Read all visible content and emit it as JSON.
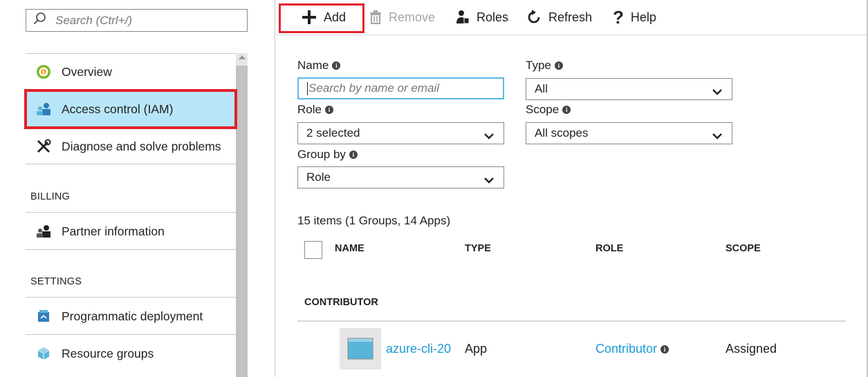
{
  "left": {
    "search_placeholder": "Search (Ctrl+/)",
    "items": [
      {
        "label": "Overview",
        "icon": "overview-icon"
      },
      {
        "label": "Access control (IAM)",
        "icon": "iam-icon",
        "active": true
      },
      {
        "label": "Diagnose and solve problems",
        "icon": "wrench-icon"
      }
    ],
    "sections": [
      {
        "title": "BILLING",
        "items": [
          {
            "label": "Partner information",
            "icon": "users-icon"
          }
        ]
      },
      {
        "title": "SETTINGS",
        "items": [
          {
            "label": "Programmatic deployment",
            "icon": "deployment-icon"
          },
          {
            "label": "Resource groups",
            "icon": "resource-group-icon"
          }
        ]
      }
    ]
  },
  "toolbar": {
    "add": "Add",
    "remove": "Remove",
    "roles": "Roles",
    "refresh": "Refresh",
    "help": "Help"
  },
  "filters": {
    "name_label": "Name",
    "name_placeholder": "Search by name or email",
    "type_label": "Type",
    "type_value": "All",
    "role_label": "Role",
    "role_value": "2 selected",
    "scope_label": "Scope",
    "scope_value": "All scopes",
    "groupby_label": "Group by",
    "groupby_value": "Role"
  },
  "table": {
    "count": "15 items (1 Groups, 14 Apps)",
    "columns": [
      "NAME",
      "TYPE",
      "ROLE",
      "SCOPE"
    ],
    "group": "CONTRIBUTOR",
    "rows": [
      {
        "name": "azure-cli-20",
        "type": "App",
        "role": "Contributor",
        "scope": "Assigned"
      }
    ]
  },
  "colors": {
    "accent": "#1a9bd7",
    "highlight": "#e3212b",
    "active_bg": "#b8e6f8"
  }
}
